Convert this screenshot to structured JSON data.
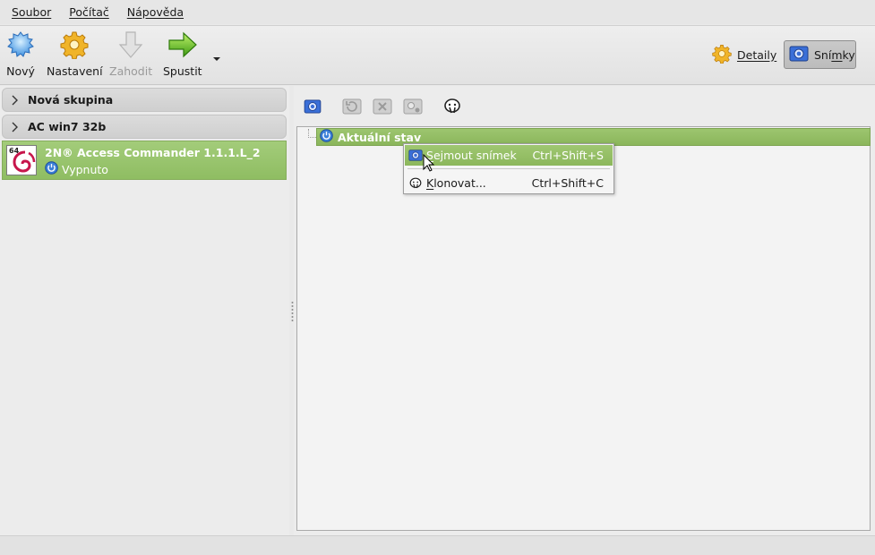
{
  "menubar": {
    "items": [
      {
        "label": "Soubor"
      },
      {
        "label": "Počítač"
      },
      {
        "label": "Nápověda"
      }
    ]
  },
  "toolbar": {
    "new_label": "Nový",
    "settings_label": "Nastavení",
    "discard_label": "Zahodit",
    "start_label": "Spustit",
    "details_label": "Detaily",
    "snapshots_label_a": "Sní",
    "snapshots_label_b": "m",
    "snapshots_label_c": "ky"
  },
  "sidebar": {
    "groups": [
      {
        "label": "Nová skupina"
      },
      {
        "label": "AC win7 32b"
      }
    ],
    "vm": {
      "name": "2N® Access Commander 1.1.1.L_2",
      "state": "Vypnuto",
      "os_badge": "64"
    }
  },
  "snapshots": {
    "current_state": "Aktuální stav"
  },
  "context_menu": {
    "items": [
      {
        "label_first": "S",
        "label_rest": "ejmout snímek",
        "shortcut": "Ctrl+Shift+S"
      },
      {
        "label_first": "K",
        "label_rest": "lonovat...",
        "shortcut": "Ctrl+Shift+C"
      }
    ]
  },
  "colors": {
    "selection_green": "#8fbd62",
    "accent_blue": "#3a6fd8"
  }
}
